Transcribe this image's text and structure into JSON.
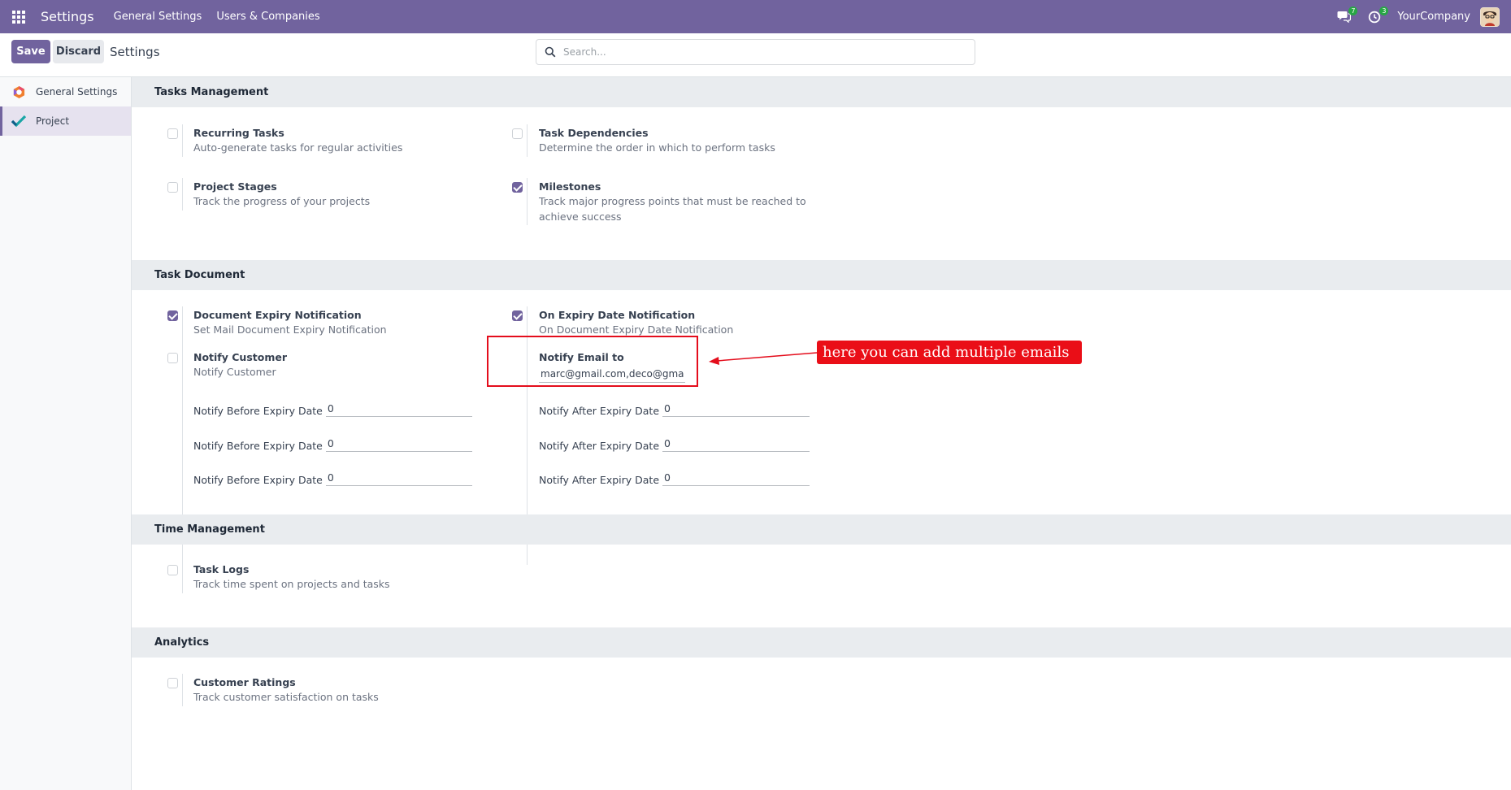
{
  "navbar": {
    "app_title": "Settings",
    "menus": [
      "General Settings",
      "Users & Companies"
    ],
    "messages_count": "7",
    "activities_count": "3",
    "company": "YourCompany",
    "bg_color": "#71639e"
  },
  "control": {
    "save_label": "Save",
    "discard_label": "Discard",
    "breadcrumb": "Settings",
    "search_placeholder": "Search..."
  },
  "sidebar": {
    "items": [
      {
        "label": "General Settings",
        "icon": "odoo-logo-icon"
      },
      {
        "label": "Project",
        "icon": "project-check-icon",
        "active": true
      }
    ]
  },
  "sections": {
    "tasks_management": {
      "title": "Tasks Management",
      "recurring": {
        "title": "Recurring Tasks",
        "desc": "Auto-generate tasks for regular activities",
        "checked": false
      },
      "dependencies": {
        "title": "Task Dependencies",
        "desc": "Determine the order in which to perform tasks",
        "checked": false
      },
      "stages": {
        "title": "Project Stages",
        "desc": "Track the progress of your projects",
        "checked": false
      },
      "milestones": {
        "title": "Milestones",
        "desc": "Track major progress points that must be reached to achieve success",
        "checked": true
      }
    },
    "task_document": {
      "title": "Task Document",
      "expiry_notification": {
        "title": "Document Expiry Notification",
        "desc": "Set Mail Document Expiry Notification",
        "checked": true
      },
      "on_expiry": {
        "title": "On Expiry Date Notification",
        "desc": "On Document Expiry Date Notification",
        "checked": true
      },
      "notify_customer": {
        "title": "Notify Customer",
        "desc": "Notify Customer",
        "checked": false
      },
      "notify_email": {
        "title": "Notify Email to",
        "value": "marc@gmail.com,deco@gmail."
      },
      "before_label": "Notify Before Expiry Date",
      "after_label": "Notify After Expiry Date",
      "before_values": [
        "0",
        "0",
        "0"
      ],
      "after_values": [
        "0",
        "0",
        "0"
      ]
    },
    "time_management": {
      "title": "Time Management",
      "task_logs": {
        "title": "Task Logs",
        "desc": "Track time spent on projects and tasks",
        "checked": false
      }
    },
    "analytics": {
      "title": "Analytics",
      "ratings": {
        "title": "Customer Ratings",
        "desc": "Track customer satisfaction on tasks",
        "checked": false
      }
    }
  },
  "annotation": {
    "text": "here you can add multiple emails",
    "color": "#ea0e17"
  }
}
